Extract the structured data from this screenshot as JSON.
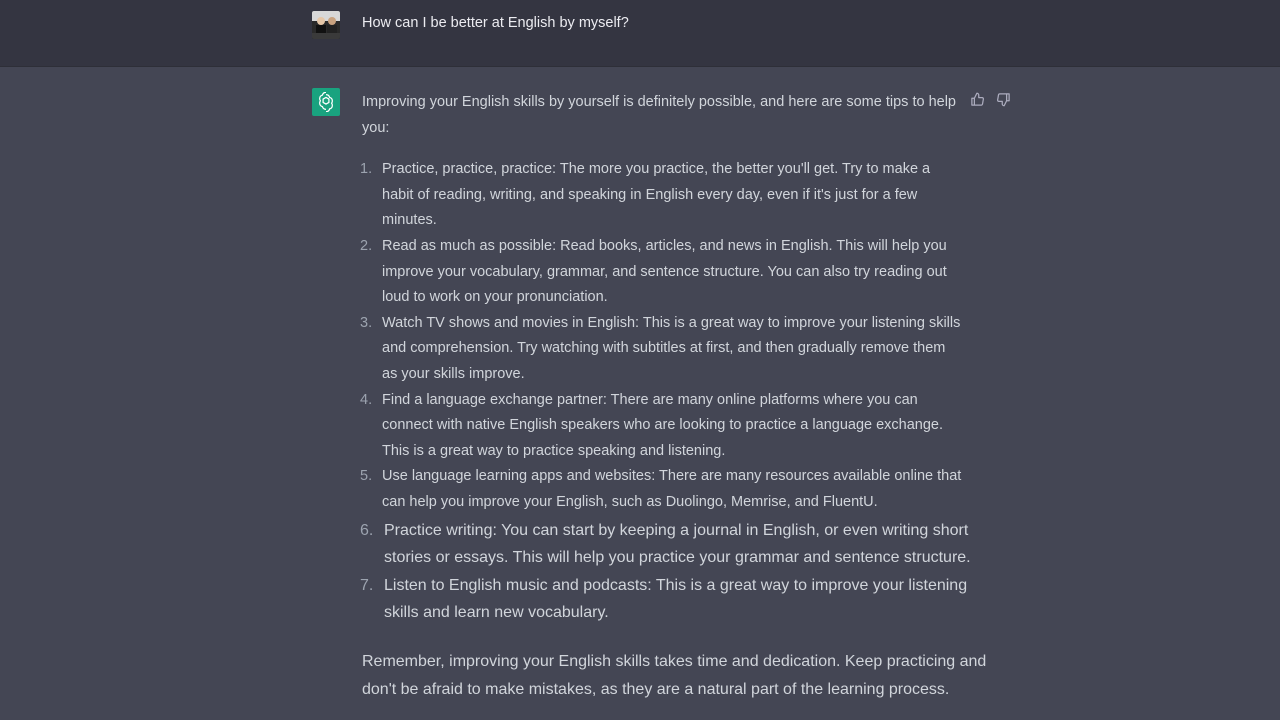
{
  "user_message": {
    "avatar": "user-photo-avatar",
    "text": "How can I be better at English by myself?"
  },
  "assistant_message": {
    "avatar": "openai-logo-icon",
    "intro": "Improving your English skills by yourself is definitely possible, and here are some tips to help you:",
    "tips": [
      {
        "num": "1.",
        "text": "Practice, practice, practice: The more you practice, the better you'll get. Try to make a habit of reading, writing, and speaking in English every day, even if it's just for a few minutes."
      },
      {
        "num": "2.",
        "text": "Read as much as possible: Read books, articles, and news in English. This will help you improve your vocabulary, grammar, and sentence structure. You can also try reading out loud to work on your pronunciation."
      },
      {
        "num": "3.",
        "text": "Watch TV shows and movies in English: This is a great way to improve your listening skills and comprehension. Try watching with subtitles at first, and then gradually remove them as your skills improve."
      },
      {
        "num": "4.",
        "text": "Find a language exchange partner: There are many online platforms where you can connect with native English speakers who are looking to practice a language exchange. This is a great way to practice speaking and listening."
      },
      {
        "num": "5.",
        "text": "Use language learning apps and websites: There are many resources available online that can help you improve your English, such as Duolingo, Memrise, and FluentU."
      },
      {
        "num": "6.",
        "text": "Practice writing: You can start by keeping a journal in English, or even writing short stories or essays. This will help you practice your grammar and sentence structure."
      },
      {
        "num": "7.",
        "text": "Listen to English music and podcasts: This is a great way to improve your listening skills and learn new vocabulary."
      }
    ],
    "outro": "Remember, improving your English skills takes time and dedication. Keep practicing and don't be afraid to make mistakes, as they are a natural part of the learning process.",
    "feedback": {
      "thumbs_up_icon": "thumbs-up-icon",
      "thumbs_down_icon": "thumbs-down-icon"
    }
  },
  "colors": {
    "user_row_bg": "#343541",
    "assistant_row_bg": "#444654",
    "assistant_avatar_bg": "#19a37f",
    "text": "#d1d5db"
  }
}
